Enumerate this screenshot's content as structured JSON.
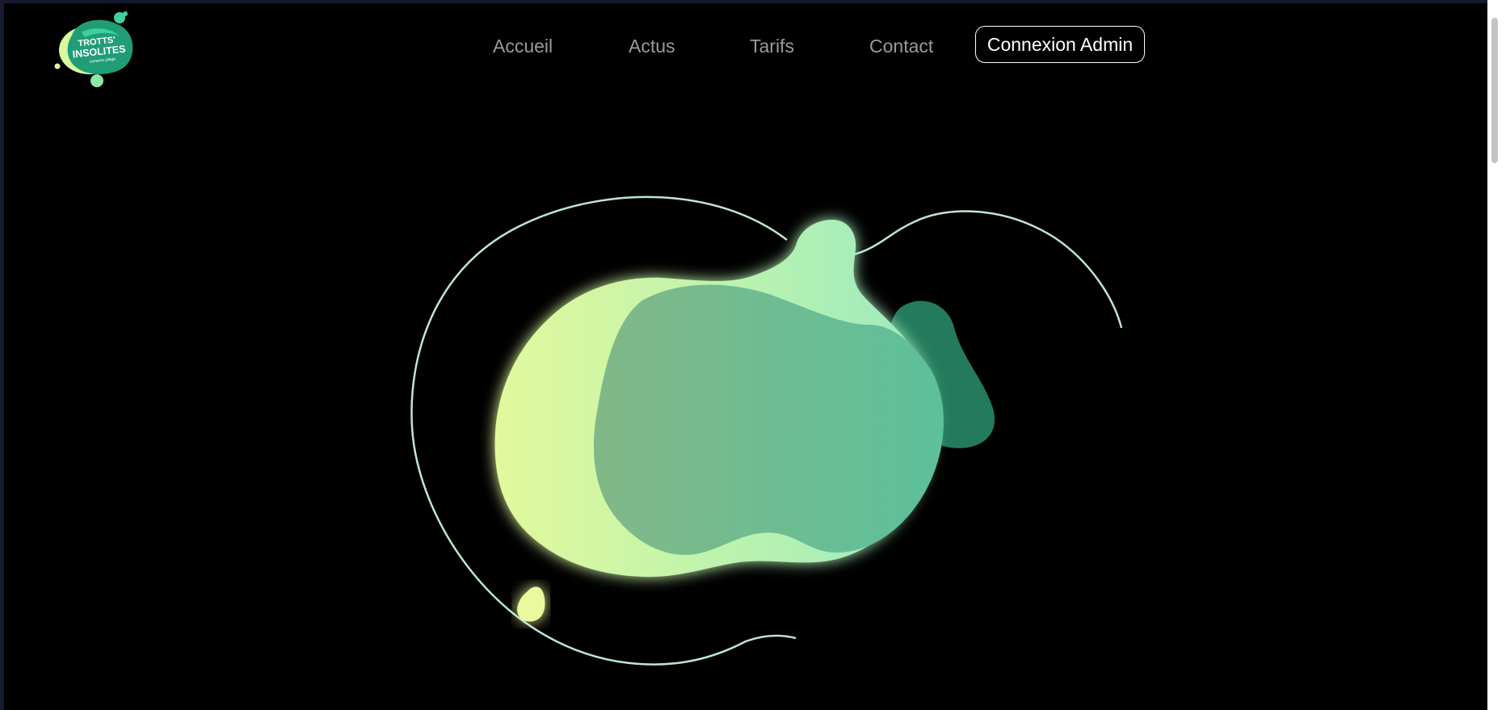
{
  "logo": {
    "line1": "TROTTS'",
    "line2": "INSOLITES",
    "tagline": "canaries plage"
  },
  "nav": {
    "items": [
      {
        "label": "Accueil"
      },
      {
        "label": "Actus"
      },
      {
        "label": "Tarifs"
      },
      {
        "label": "Contact"
      }
    ],
    "admin_label": "Connexion Admin"
  },
  "colors": {
    "background": "#000000",
    "nav_text": "#9b9b9b",
    "accent_light": "#d9f9a0",
    "accent_mint": "#8ee8c0",
    "accent_teal": "#5fbf98",
    "accent_dark": "#247a5c"
  }
}
